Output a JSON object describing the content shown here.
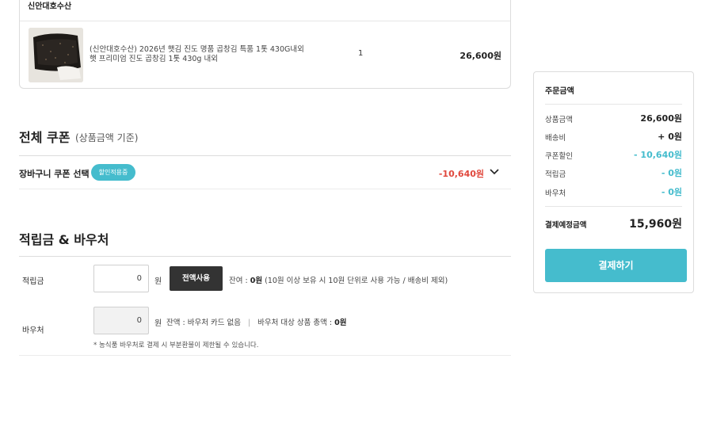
{
  "seller": {
    "name": "신안대호수산",
    "product": {
      "name": "(신안대호수산) 2026년 햇김 진도 명품 곱창김 특품 1톳 430G내외 햇 프리미엄 진도 곱창김 1톳 430g 내외",
      "quantity": "1",
      "price": "26,600원"
    }
  },
  "coupon": {
    "title": "전체 쿠폰",
    "subtitle": "(상품금액 기준)",
    "cart_label": "장바구니 쿠폰 선택",
    "badge": "할인적용중",
    "amount": "-10,640원"
  },
  "points": {
    "title": "적립금 & 바우처",
    "points_label": "적립금",
    "points_value": "0",
    "won": "원",
    "use_all": "전액사용",
    "balance_prefix": "잔여 : ",
    "balance_value": "0원",
    "balance_note": " (10원 이상 보유 시 10원 단위로 사용 가능 / 배송비 제외)",
    "voucher_label": "바우처",
    "voucher_value": "0",
    "voucher_balance": "잔액 : 바우처 카드 없음",
    "separator": "|",
    "voucher_total_prefix": "바우처 대상 상품 총액 : ",
    "voucher_total_value": "0원",
    "note": "* 농식품 바우처로 결제 시 부분환불이 제한될 수 있습니다."
  },
  "summary": {
    "title": "주문금액",
    "rows": [
      {
        "label": "상품금액",
        "value": "26,600원"
      },
      {
        "label": "배송비",
        "value": "+ 0원"
      },
      {
        "label": "쿠폰할인",
        "value": "- 10,640원"
      },
      {
        "label": "적립금",
        "value": "- 0원"
      },
      {
        "label": "바우처",
        "value": "- 0원"
      }
    ],
    "total_label": "결제예정금액",
    "total_value": "15,960원",
    "pay_button": "결제하기"
  },
  "colors": {
    "accent": "#45bccd",
    "discount": "#e0473c",
    "dark_button": "#333333"
  }
}
